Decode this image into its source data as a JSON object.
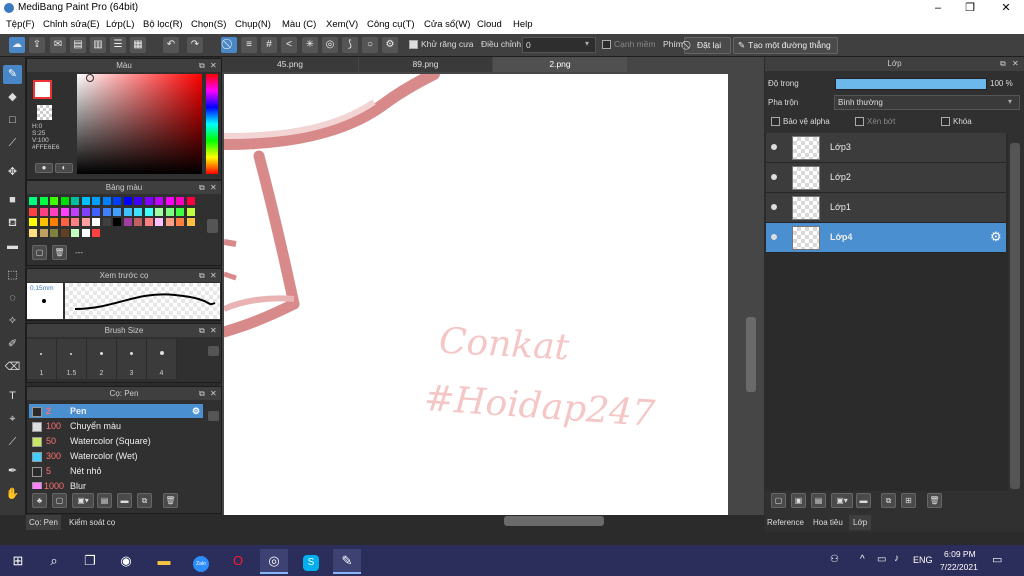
{
  "app": {
    "title": "MediBang Paint Pro (64bit)"
  },
  "menu": [
    "Tệp(F)",
    "Chỉnh sửa(E)",
    "Lớp(L)",
    "Bộ lọc(R)",
    "Chọn(S)",
    "Chụp(N)",
    "Màu (C)",
    "Xem(V)",
    "Công cụ(T)",
    "Cửa sổ(W)",
    "Cloud",
    "Help"
  ],
  "toolbar": {
    "antialias_label": "Khử răng cưa",
    "adjust_label": "Điều chỉnh",
    "adjust_value": "0",
    "edge_label": "Cạnh mềm",
    "key_label": "Phím",
    "reset_label": "Đặt lại",
    "straight_line_label": "Tạo một đường thẳng"
  },
  "color_panel": {
    "title": "Màu",
    "h_label": "H:0",
    "s_label": "S:25",
    "v_label": "V:100",
    "hex": "#FFE6E6",
    "fg_color": "#FFE6E6"
  },
  "palette_panel": {
    "title": "Bảng màu",
    "footer": "---",
    "colors": [
      "#00ff80",
      "#00ff40",
      "#40ff00",
      "#00e000",
      "#00c0a0",
      "#00c0ff",
      "#00a0ff",
      "#0080ff",
      "#0040ff",
      "#0000ff",
      "#4000ff",
      "#8000ff",
      "#c000ff",
      "#ff00ff",
      "#ff00c0",
      "#ff0040",
      "#ff4040",
      "#ff4080",
      "#ff40c0",
      "#ff40ff",
      "#c040ff",
      "#8040ff",
      "#4060ff",
      "#4080ff",
      "#40a0ff",
      "#40c0ff",
      "#40e0ff",
      "#40ffff",
      "#a0ffa0",
      "#80ff80",
      "#40ff40",
      "#c0ff40",
      "#ffff00",
      "#ffc000",
      "#ff8000",
      "#ff6040",
      "#ff8080",
      "#ffa0a0",
      "#ffffff",
      "#404040",
      "#000000",
      "#a040a0",
      "#c06060",
      "#ff8080",
      "#ffc0ff",
      "#ffa080",
      "#ff8040",
      "#ffc040",
      "#ffe080",
      "#c0a060",
      "#808040",
      "#604020",
      "#c0ffc0",
      "#ffffff",
      "#ff4040"
    ]
  },
  "preview_panel": {
    "title": "Xem trước cọ",
    "size": "0.15mm"
  },
  "brushsize_panel": {
    "title": "Brush Size",
    "sizes": [
      "1",
      "1.5",
      "2",
      "3",
      "4"
    ]
  },
  "brush_panel": {
    "title": "Cọ: Pen",
    "items": [
      {
        "num": "2",
        "name": "Pen",
        "color": "#2b2b2b"
      },
      {
        "num": "100",
        "name": "Chuyển màu",
        "color": "#dddddd"
      },
      {
        "num": "50",
        "name": "Watercolor (Square)",
        "color": "#c8e860"
      },
      {
        "num": "300",
        "name": "Watercolor (Wet)",
        "color": "#40d0ff"
      },
      {
        "num": "5",
        "name": "Nét nhỏ",
        "color": "#2b2b2b"
      },
      {
        "num": "1000",
        "name": "Blur",
        "color": "#ff80ff"
      }
    ]
  },
  "left_bottom_tabs": [
    "Cọ: Pen",
    "Kiểm soát cọ"
  ],
  "canvas_tabs": [
    "45.png",
    "89.png",
    "2.png"
  ],
  "canvas_text": {
    "line1": "Conkat",
    "line2": "#Hoidap247"
  },
  "layer_panel": {
    "title": "Lớp",
    "opacity_label": "Độ trong",
    "opacity_value": "100 %",
    "opacity_fraction": 1.0,
    "blend_label": "Pha trộn",
    "blend_value": "Bình thường",
    "protect_alpha": "Bảo vệ alpha",
    "clip": "Xén bớt",
    "lock": "Khóa",
    "layers": [
      "Lớp3",
      "Lớp2",
      "Lớp1",
      "Lớp4"
    ],
    "selected": "Lớp4"
  },
  "right_bottom_tabs": [
    "Reference",
    "Hoa tiêu",
    "Lớp"
  ],
  "taskbar": {
    "lang": "ENG",
    "time": "6:09 PM",
    "date": "7/22/2021"
  }
}
